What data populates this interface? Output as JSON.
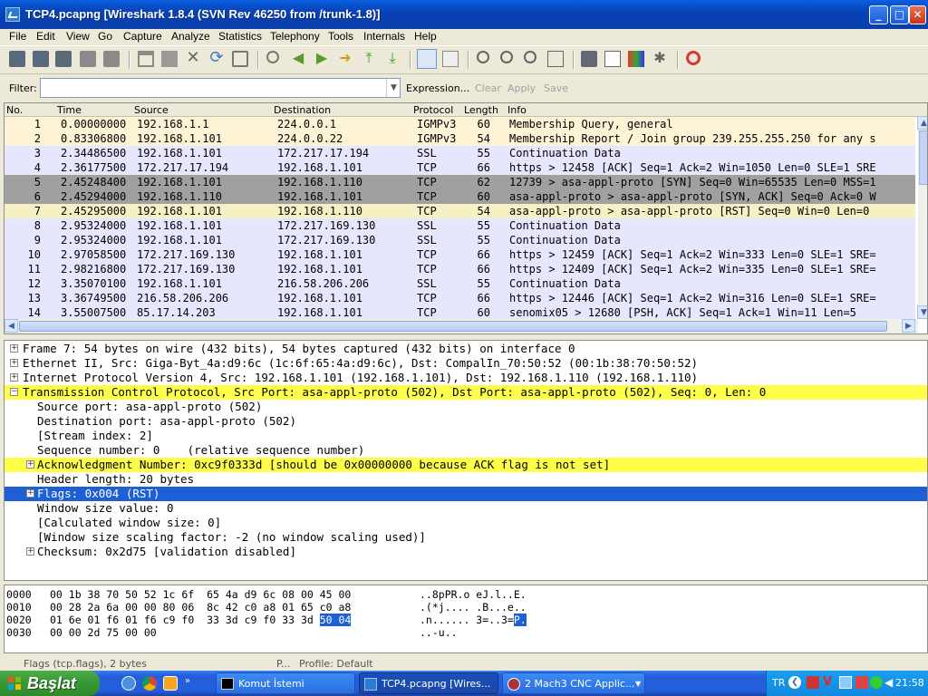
{
  "window": {
    "title": "TCP4.pcapng  [Wireshark 1.8.4  (SVN Rev 46250 from /trunk-1.8)]",
    "minimize": "_",
    "maximize": "□",
    "close": "✕"
  },
  "menu": [
    "File",
    "Edit",
    "View",
    "Go",
    "Capture",
    "Analyze",
    "Statistics",
    "Telephony",
    "Tools",
    "Internals",
    "Help"
  ],
  "filter": {
    "label": "Filter:",
    "value": "",
    "expression": "Expression...",
    "clear": "Clear",
    "apply": "Apply",
    "save": "Save"
  },
  "packet_list": {
    "columns": [
      "No.",
      "Time",
      "Source",
      "Destination",
      "Protocol",
      "Length",
      "Info"
    ],
    "rows": [
      {
        "no": "1",
        "time": "0.00000000",
        "src": "192.168.1.1",
        "dst": "224.0.0.1",
        "proto": "IGMPv3",
        "len": "60",
        "info": "Membership Query, general",
        "bg": "#fff3d6",
        "fg": "#000000"
      },
      {
        "no": "2",
        "time": "0.83306800",
        "src": "192.168.1.101",
        "dst": "224.0.0.22",
        "proto": "IGMPv3",
        "len": "54",
        "info": "Membership Report / Join group 239.255.255.250 for any s",
        "bg": "#fff3d6",
        "fg": "#000000"
      },
      {
        "no": "3",
        "time": "2.34486500",
        "src": "192.168.1.101",
        "dst": "172.217.17.194",
        "proto": "SSL",
        "len": "55",
        "info": "Continuation Data",
        "bg": "#e7e6ff",
        "fg": "#000000"
      },
      {
        "no": "4",
        "time": "2.36177500",
        "src": "172.217.17.194",
        "dst": "192.168.1.101",
        "proto": "TCP",
        "len": "66",
        "info": "https > 12458 [ACK] Seq=1 Ack=2 Win=1050 Len=0 SLE=1 SRE",
        "bg": "#e7e6ff",
        "fg": "#000000"
      },
      {
        "no": "5",
        "time": "2.45248400",
        "src": "192.168.1.101",
        "dst": "192.168.1.110",
        "proto": "TCP",
        "len": "62",
        "info": "12739 > asa-appl-proto [SYN] Seq=0 Win=65535 Len=0 MSS=1",
        "bg": "#a0a0a0",
        "fg": "#000000"
      },
      {
        "no": "6",
        "time": "2.45294000",
        "src": "192.168.1.110",
        "dst": "192.168.1.101",
        "proto": "TCP",
        "len": "60",
        "info": "asa-appl-proto > asa-appl-proto [SYN, ACK] Seq=0 Ack=0 W",
        "bg": "#a0a0a0",
        "fg": "#000000"
      },
      {
        "no": "7",
        "time": "2.45295000",
        "src": "192.168.1.101",
        "dst": "192.168.1.110",
        "proto": "TCP",
        "len": "54",
        "info": "asa-appl-proto > asa-appl-proto [RST] Seq=0 Win=0 Len=0",
        "bg": "#f5f1c4",
        "fg": "#000000"
      },
      {
        "no": "8",
        "time": "2.95324000",
        "src": "192.168.1.101",
        "dst": "172.217.169.130",
        "proto": "SSL",
        "len": "55",
        "info": "Continuation Data",
        "bg": "#e7e6ff",
        "fg": "#000000"
      },
      {
        "no": "9",
        "time": "2.95324000",
        "src": "192.168.1.101",
        "dst": "172.217.169.130",
        "proto": "SSL",
        "len": "55",
        "info": "Continuation Data",
        "bg": "#e7e6ff",
        "fg": "#000000"
      },
      {
        "no": "10",
        "time": "2.97058500",
        "src": "172.217.169.130",
        "dst": "192.168.1.101",
        "proto": "TCP",
        "len": "66",
        "info": "https > 12459 [ACK] Seq=1 Ack=2 Win=333 Len=0 SLE=1 SRE=",
        "bg": "#e7e6ff",
        "fg": "#000000"
      },
      {
        "no": "11",
        "time": "2.98216800",
        "src": "172.217.169.130",
        "dst": "192.168.1.101",
        "proto": "TCP",
        "len": "66",
        "info": "https > 12409 [ACK] Seq=1 Ack=2 Win=335 Len=0 SLE=1 SRE=",
        "bg": "#e7e6ff",
        "fg": "#000000"
      },
      {
        "no": "12",
        "time": "3.35070100",
        "src": "192.168.1.101",
        "dst": "216.58.206.206",
        "proto": "SSL",
        "len": "55",
        "info": "Continuation Data",
        "bg": "#e7e6ff",
        "fg": "#000000"
      },
      {
        "no": "13",
        "time": "3.36749500",
        "src": "216.58.206.206",
        "dst": "192.168.1.101",
        "proto": "TCP",
        "len": "66",
        "info": "https > 12446 [ACK] Seq=1 Ack=2 Win=316 Len=0 SLE=1 SRE=",
        "bg": "#e7e6ff",
        "fg": "#000000"
      },
      {
        "no": "14",
        "time": "3.55007500",
        "src": "85.17.14.203",
        "dst": "192.168.1.101",
        "proto": "TCP",
        "len": "60",
        "info": "senomix05 > 12680 [PSH, ACK] Seq=1 Ack=1 Win=11 Len=5",
        "bg": "#e7e6ff",
        "fg": "#000000"
      }
    ]
  },
  "details": [
    {
      "exp": "+",
      "indent": 0,
      "text": "Frame 7: 54 bytes on wire (432 bits), 54 bytes captured (432 bits) on interface 0",
      "style": "normal"
    },
    {
      "exp": "+",
      "indent": 0,
      "text": "Ethernet II, Src: Giga-Byt_4a:d9:6c (1c:6f:65:4a:d9:6c), Dst: CompalIn_70:50:52 (00:1b:38:70:50:52)",
      "style": "normal"
    },
    {
      "exp": "+",
      "indent": 0,
      "text": "Internet Protocol Version 4, Src: 192.168.1.101 (192.168.1.101), Dst: 192.168.1.110 (192.168.1.110)",
      "style": "normal"
    },
    {
      "exp": "-",
      "indent": 0,
      "text": "Transmission Control Protocol, Src Port: asa-appl-proto (502), Dst Port: asa-appl-proto (502), Seq: 0, Len: 0",
      "style": "warn"
    },
    {
      "exp": "",
      "indent": 1,
      "text": "Source port: asa-appl-proto (502)",
      "style": "normal"
    },
    {
      "exp": "",
      "indent": 1,
      "text": "Destination port: asa-appl-proto (502)",
      "style": "normal"
    },
    {
      "exp": "",
      "indent": 1,
      "text": "[Stream index: 2]",
      "style": "normal"
    },
    {
      "exp": "",
      "indent": 1,
      "text": "Sequence number: 0    (relative sequence number)",
      "style": "normal"
    },
    {
      "exp": "+",
      "indent": 1,
      "text": "Acknowledgment Number: 0xc9f0333d [should be 0x00000000 because ACK flag is not set]",
      "style": "warn"
    },
    {
      "exp": "",
      "indent": 1,
      "text": "Header length: 20 bytes",
      "style": "normal"
    },
    {
      "exp": "+",
      "indent": 1,
      "text": "Flags: 0x004 (RST)",
      "style": "selected"
    },
    {
      "exp": "",
      "indent": 1,
      "text": "Window size value: 0",
      "style": "normal"
    },
    {
      "exp": "",
      "indent": 1,
      "text": "[Calculated window size: 0]",
      "style": "normal"
    },
    {
      "exp": "",
      "indent": 1,
      "text": "[Window size scaling factor: -2 (no window scaling used)]",
      "style": "normal"
    },
    {
      "exp": "+",
      "indent": 1,
      "text": "Checksum: 0x2d75 [validation disabled]",
      "style": "normal"
    }
  ],
  "hex": [
    {
      "off": "0000",
      "bytes": "00 1b 38 70 50 52 1c 6f  65 4a d9 6c 08 00 45 00",
      "hl": "",
      "ascii": "..8pPR.o eJ.l..E.",
      "ahl": ""
    },
    {
      "off": "0010",
      "bytes": "00 28 2a 6a 00 00 80 06  8c 42 c0 a8 01 65 c0 a8",
      "hl": "",
      "ascii": ".(*j.... .B...e..",
      "ahl": ""
    },
    {
      "off": "0020",
      "bytes": "01 6e 01 f6 01 f6 c9 f0  33 3d c9 f0 33 3d ",
      "hl": "50 04",
      "ascii": ".n...... 3=..3=",
      "ahl": "P."
    },
    {
      "off": "0030",
      "bytes": "00 00 2d 75 00 00",
      "hl": "",
      "ascii": "..-u..",
      "ahl": ""
    }
  ],
  "status": {
    "left": "Flags (tcp.flags), 2 bytes",
    "mid": "P...",
    "right": "Profile: Default"
  },
  "taskbar": {
    "start": "Başlat",
    "tasks": [
      "Komut İstemi",
      "TCP4.pcapng  [Wires...",
      "2 Mach3 CNC Applic..."
    ],
    "lang": "TR",
    "clock": "21:58"
  },
  "colors": {
    "selected": "#1f5fd6",
    "warn": "#ffff4a",
    "accent": "#245edb"
  }
}
